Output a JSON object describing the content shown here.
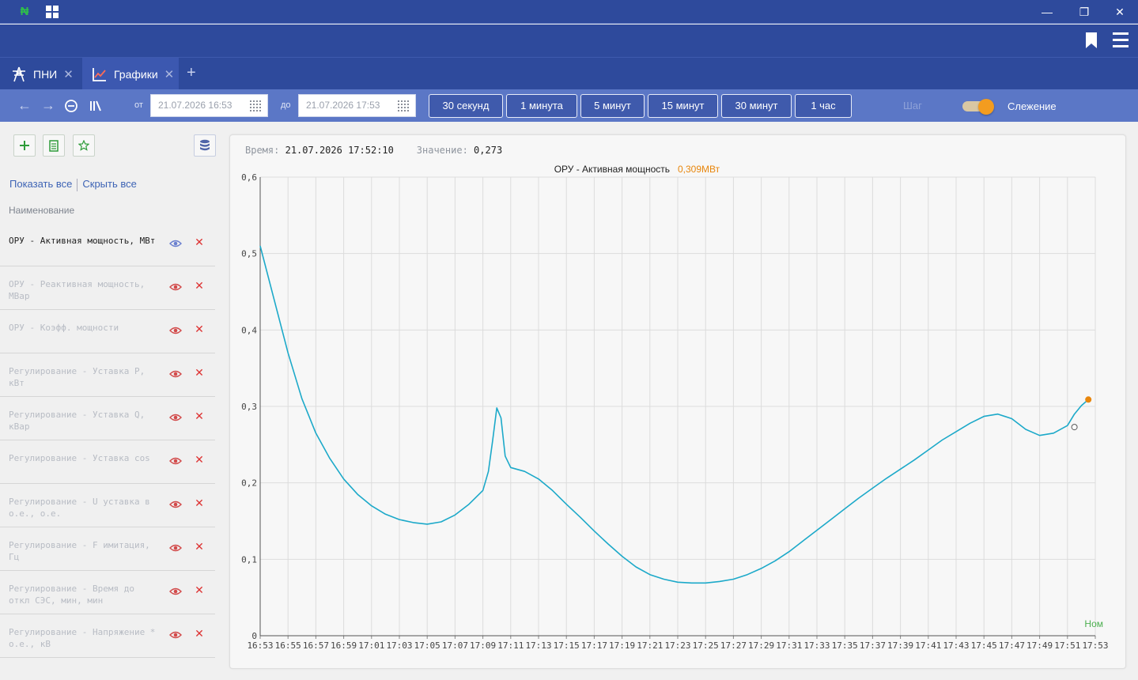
{
  "window": {
    "minimize": "—",
    "maximize": "❐",
    "close": "✕"
  },
  "tabs": [
    {
      "label": "ПНИ",
      "icon": "transmission-tower-icon"
    },
    {
      "label": "Графики",
      "icon": "chart-icon"
    }
  ],
  "tab_add": "+",
  "toolbar": {
    "from_label": "от",
    "from_value": "21.07.2026 16:53",
    "to_label": "до",
    "to_value": "21.07.2026 17:53",
    "ranges": [
      "30 секунд",
      "1 минута",
      "5 минут",
      "15 минут",
      "30 минут",
      "1 час"
    ],
    "step_label": "Шаг",
    "follow_label": "Слежение",
    "follow_on": true
  },
  "sidebar": {
    "show_all": "Показать все",
    "hide_all": "Скрыть все",
    "column_header": "Наименование",
    "items": [
      {
        "label": "ОРУ - Активная мощность, МВт",
        "active": true
      },
      {
        "label": "ОРУ - Реактивная мощность, МВар",
        "active": false
      },
      {
        "label": "ОРУ - Коэфф. мощности",
        "active": false
      },
      {
        "label": "Регулирование - Уставка P, кВт",
        "active": false
      },
      {
        "label": "Регулирование - Уставка Q, кВар",
        "active": false
      },
      {
        "label": "Регулирование - Уставка cos",
        "active": false
      },
      {
        "label": "Регулирование - U уставка в о.е., о.е.",
        "active": false
      },
      {
        "label": "Регулирование - F имитация, Гц",
        "active": false
      },
      {
        "label": "Регулирование - Время до откл СЭС, мин, мин",
        "active": false
      },
      {
        "label": "Регулирование - Напряжение * о.е., кВ",
        "active": false
      }
    ]
  },
  "readout": {
    "time_label": "Время:",
    "time_value": "21.07.2026 17:52:10",
    "value_label": "Значение:",
    "value_value": "0,273"
  },
  "colors": {
    "line": "#1ca9c9",
    "accent": "#e8860c",
    "nom": "#4caf50"
  },
  "chart_data": {
    "type": "line",
    "title": "ОРУ - Активная мощность",
    "current_value": "0,309МВт",
    "ylim": [
      0,
      0.6
    ],
    "yticks": [
      "0",
      "0,1",
      "0,2",
      "0,3",
      "0,4",
      "0,5",
      "0,6"
    ],
    "xticks": [
      "16:53",
      "16:55",
      "16:57",
      "16:59",
      "17:01",
      "17:03",
      "17:05",
      "17:07",
      "17:09",
      "17:11",
      "17:13",
      "17:15",
      "17:17",
      "17:19",
      "17:21",
      "17:23",
      "17:25",
      "17:27",
      "17:29",
      "17:31",
      "17:33",
      "17:35",
      "17:37",
      "17:39",
      "17:41",
      "17:43",
      "17:45",
      "17:47",
      "17:49",
      "17:51",
      "17:53"
    ],
    "xlim_minutes": [
      0,
      60
    ],
    "nom_label": "Ном",
    "series": [
      {
        "x": [
          0,
          1,
          2,
          3,
          4,
          5,
          6,
          7,
          8,
          9,
          10,
          11,
          12,
          13,
          14,
          15,
          16,
          16.4,
          16.7,
          17.0,
          17.3,
          17.6,
          18,
          19,
          20,
          21,
          22,
          23,
          24,
          25,
          26,
          27,
          28,
          29,
          30,
          31,
          32,
          33,
          34,
          35,
          36,
          37,
          38,
          39,
          40,
          41,
          42,
          43,
          44,
          45,
          46,
          47,
          48,
          49,
          50,
          51,
          52,
          53,
          54,
          55,
          56,
          57,
          58,
          58.5,
          59,
          59.5
        ],
        "y": [
          0.51,
          0.44,
          0.37,
          0.31,
          0.265,
          0.232,
          0.205,
          0.185,
          0.17,
          0.159,
          0.152,
          0.148,
          0.146,
          0.149,
          0.158,
          0.172,
          0.19,
          0.215,
          0.255,
          0.298,
          0.285,
          0.235,
          0.22,
          0.215,
          0.205,
          0.19,
          0.172,
          0.155,
          0.137,
          0.12,
          0.104,
          0.09,
          0.08,
          0.074,
          0.07,
          0.069,
          0.069,
          0.071,
          0.074,
          0.08,
          0.088,
          0.098,
          0.11,
          0.124,
          0.138,
          0.152,
          0.166,
          0.18,
          0.193,
          0.206,
          0.218,
          0.23,
          0.243,
          0.256,
          0.267,
          0.278,
          0.287,
          0.29,
          0.284,
          0.27,
          0.262,
          0.265,
          0.275,
          0.29,
          0.301,
          0.309
        ]
      }
    ],
    "marker_hover": {
      "x": 58.5,
      "y": 0.273
    },
    "marker_current": {
      "x": 59.5,
      "y": 0.309
    }
  }
}
